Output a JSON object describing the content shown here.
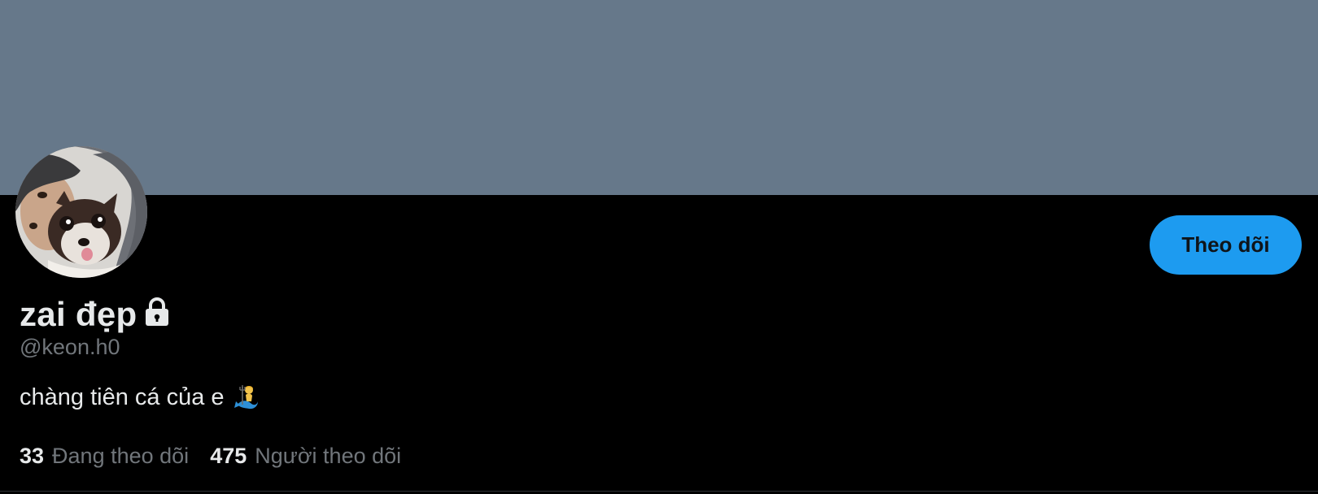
{
  "profile": {
    "display_name": "zai đẹp",
    "handle": "@keon.h0",
    "bio": "chàng tiên cá của e",
    "protected_icon": "lock-icon",
    "bio_emoji": "merman-icon"
  },
  "actions": {
    "follow_label": "Theo dõi"
  },
  "stats": {
    "following_count": "33",
    "following_label": "Đang theo dõi",
    "followers_count": "475",
    "followers_label": "Người theo dõi"
  },
  "colors": {
    "banner": "#66788a",
    "background": "#000000",
    "accent": "#1d9bf0",
    "primary_text": "#e7e9ea",
    "secondary_text": "#71767b"
  }
}
